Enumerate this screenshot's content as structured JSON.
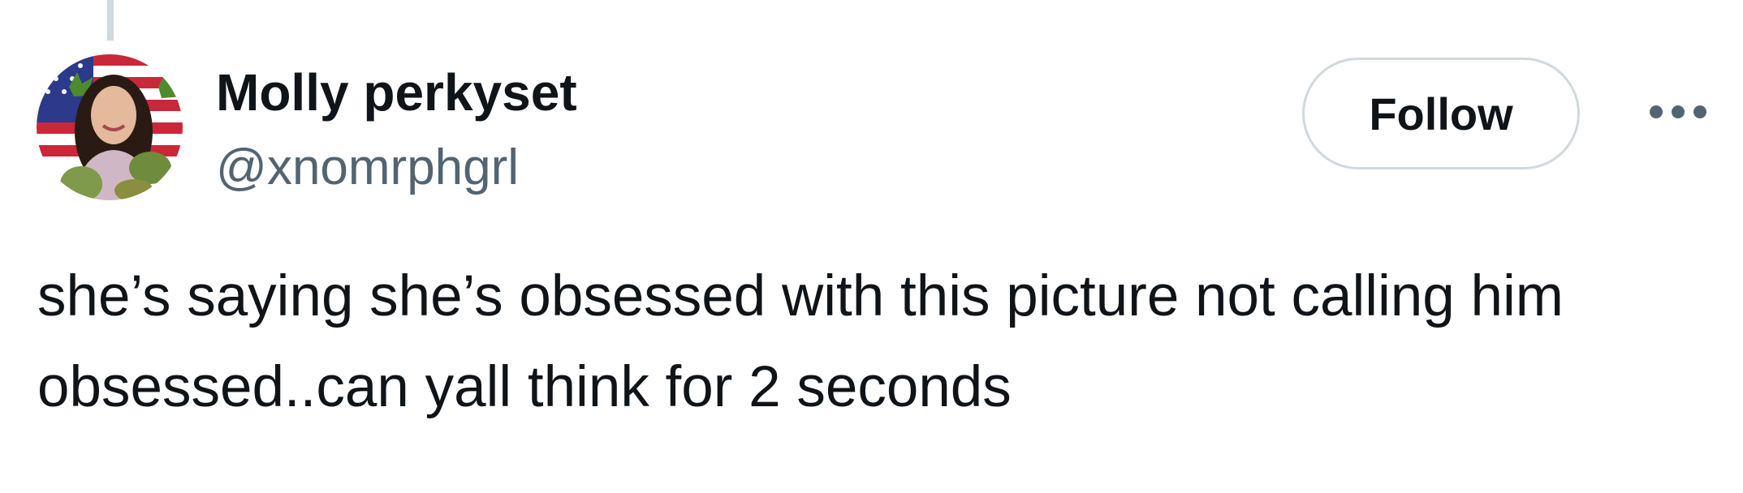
{
  "tweet": {
    "author": {
      "display_name": "Molly perkyset",
      "handle": "@xnomrphgrl",
      "avatar_icon": "profile-photo-avatar"
    },
    "follow_label": "Follow",
    "more_icon": "more-options-icon",
    "text_lines": [
      "she’s saying she’s obsessed with this picture not calling him",
      "obsessed..can yall think for 2 seconds"
    ]
  },
  "colors": {
    "text_primary": "#0f1419",
    "text_secondary": "#536471",
    "border": "#cfd9de",
    "background": "#ffffff"
  }
}
